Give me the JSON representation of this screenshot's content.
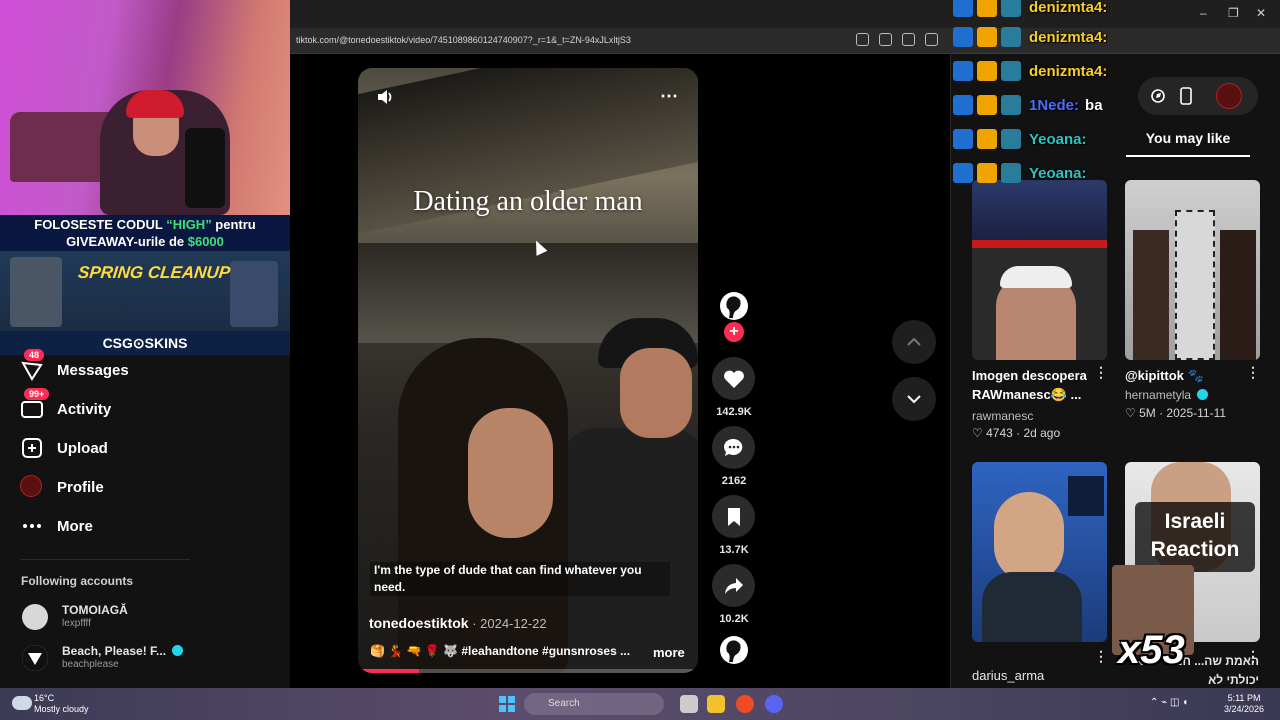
{
  "browser": {
    "url": "tiktok.com/@tonedoestiktok/video/7451089860124740907?_r=1&_t=ZN-94xJLxltjS3",
    "window_controls": [
      "–",
      "❐",
      "✕"
    ]
  },
  "stream_overlay": {
    "promo_line1_a": "FOLOSESTE CODUL ",
    "promo_line1_code": "“HIGH”",
    "promo_line1_b": " pentru",
    "promo_line2_a": "GIVEAWAY-urile de ",
    "promo_line2_amount": "$6000",
    "banner_title": "SPRING CLEANUP",
    "sponsor": "CSG⊙SKINS"
  },
  "chat": [
    {
      "user": "denizmta4:",
      "message": "",
      "color": "#f5d020"
    },
    {
      "user": "denizmta4:",
      "message": "",
      "color": "#f5d020"
    },
    {
      "user": "denizmta4:",
      "message": "",
      "color": "#f5d020"
    },
    {
      "user": "1Nede:",
      "message": "ba",
      "color": "#4a6cff"
    },
    {
      "user": "Yeoana:",
      "message": "",
      "color": "#2ec4c4"
    },
    {
      "user": "Yeoana:",
      "message": "",
      "color": "#2ec4c4"
    }
  ],
  "sidebar": {
    "items": [
      {
        "label": "Messages",
        "badge": "48"
      },
      {
        "label": "Activity",
        "badge": "99+"
      },
      {
        "label": "Upload",
        "badge": ""
      },
      {
        "label": "Profile",
        "badge": ""
      },
      {
        "label": "More",
        "badge": ""
      }
    ],
    "following_title": "Following accounts",
    "accounts": [
      {
        "name": "TOMOIAGĂ",
        "handle": "lexpffff",
        "verified": false
      },
      {
        "name": "Beach, Please! F...",
        "handle": "beachplease",
        "verified": true
      }
    ]
  },
  "video": {
    "overlay_title": "Dating an older man",
    "caption": "I'm the type of dude that can find whatever you need.",
    "author": "tonedoestiktok",
    "date": " · 2024-12-22",
    "tags": "🥞 💃 🔫 🌹 🐺 #leahandtone #gunsnroses ...",
    "more_label": "more",
    "progress": 0.18,
    "menu_icon": "⋯"
  },
  "actions": {
    "likes": "142.9K",
    "comments": "2162",
    "saves": "13.7K",
    "shares": "10.2K",
    "follow_plus": "+"
  },
  "recommendations": {
    "tab": "You may like",
    "cards": [
      {
        "title": "Imogen descopera RAWmanesc😂 ...",
        "author": "rawmanesc",
        "stats": "♡ 4743 · 2d ago",
        "verified": false,
        "thumb_text": ""
      },
      {
        "title": "@kipittok 🐾",
        "author": "hernametyla",
        "stats": "♡ 5M · 2025-11-11",
        "verified": true,
        "thumb_text": ""
      },
      {
        "title": "",
        "author": "darius_arma",
        "stats": "",
        "verified": false,
        "thumb_text": ""
      },
      {
        "title": "",
        "author": "האמת שה... חמוד שלא יכולתי לא",
        "stats": "",
        "verified": false,
        "thumb_text": "Israeli Reaction"
      }
    ],
    "emote_count": "x53"
  },
  "taskbar": {
    "temp": "16°C",
    "weather": "Mostly cloudy",
    "search": "Search",
    "time": "5:11 PM",
    "date": "3/24/2026"
  }
}
